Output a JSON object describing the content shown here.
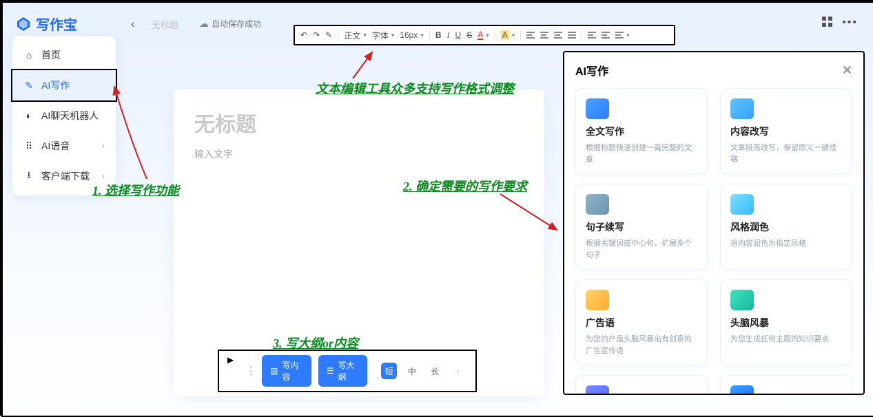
{
  "app": {
    "name": "写作宝"
  },
  "topbar": {
    "doc_tab": "无标题",
    "autosave": "自动保存成功"
  },
  "sidebar": {
    "items": [
      {
        "label": "首页"
      },
      {
        "label": "AI写作"
      },
      {
        "label": "AI聊天机器人"
      },
      {
        "label": "AI语音"
      },
      {
        "label": "客户端下载"
      }
    ]
  },
  "editor": {
    "title_placeholder": "无标题",
    "body_placeholder": "输入文字"
  },
  "toolbar": {
    "para": "正文",
    "font": "字体",
    "size": "16px",
    "bold": "B",
    "italic": "I",
    "underline": "U",
    "strike": "S",
    "color": "A",
    "highlight": "A"
  },
  "bottom": {
    "write_content": "写内容",
    "write_outline": "写大纲",
    "len_short": "短",
    "len_mid": "中",
    "len_long": "长"
  },
  "ai_panel": {
    "title": "AI写作",
    "cards": [
      {
        "title": "全文写作",
        "desc": "根据标题快速创建一篇完整的文章",
        "color": "linear-gradient(135deg,#4aa3ff,#2e7bff)"
      },
      {
        "title": "内容改写",
        "desc": "文章段落改写，保留原义一键成稿",
        "color": "linear-gradient(135deg,#5cc4ff,#3aa0ff)"
      },
      {
        "title": "句子续写",
        "desc": "根据关键词或中心句，扩展多个句子",
        "color": "linear-gradient(135deg,#8fb5c9,#6a93ab)"
      },
      {
        "title": "风格润色",
        "desc": "将内容润色为指定风格",
        "color": "linear-gradient(135deg,#7de0ff,#35b8ff)"
      },
      {
        "title": "广告语",
        "desc": "为您的产品头脑风暴出有创意的广告宣传语",
        "color": "linear-gradient(135deg,#ffd36b,#ffab2e)"
      },
      {
        "title": "头脑风暴",
        "desc": "为您生成任何主题的知识要点",
        "color": "linear-gradient(135deg,#3ee2c0,#19b89b)"
      },
      {
        "title": "",
        "desc": "",
        "color": "linear-gradient(135deg,#7a8cff,#4c63ff)"
      },
      {
        "title": "",
        "desc": "",
        "color": "linear-gradient(135deg,#3aa0ff,#1c6cf3)"
      }
    ]
  },
  "annotations": {
    "a1": "1. 选择写作功能",
    "a2": "文本编辑工具众多支持写作格式调整",
    "a3": "2. 确定需要的写作要求",
    "a4": "3. 写大纲or内容"
  }
}
